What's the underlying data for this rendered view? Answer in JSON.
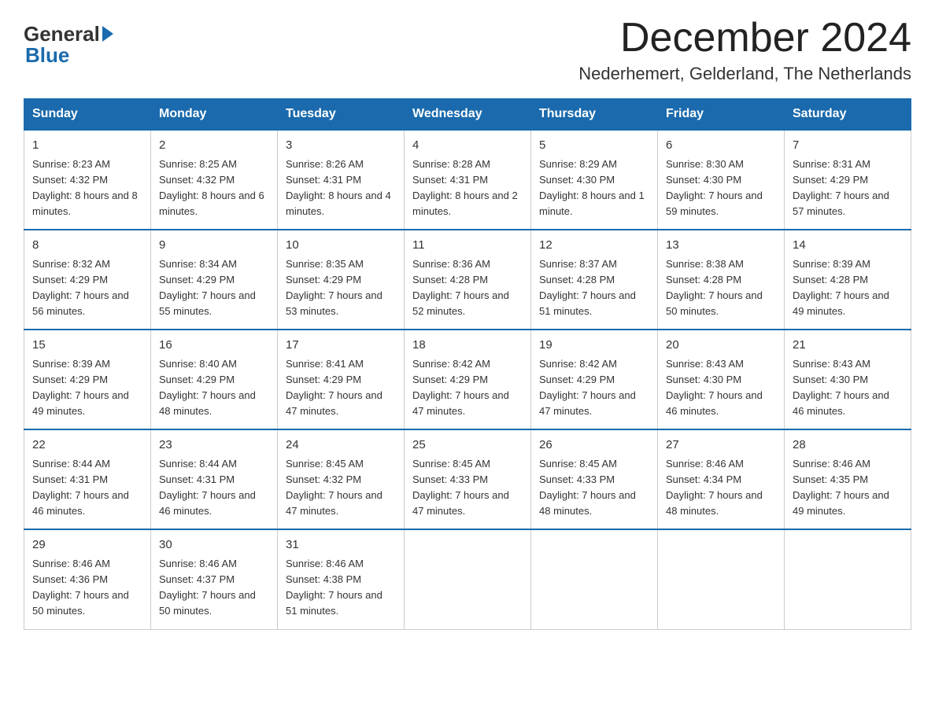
{
  "header": {
    "logo_general": "General",
    "logo_blue": "Blue",
    "month_year": "December 2024",
    "location": "Nederhemert, Gelderland, The Netherlands"
  },
  "days_of_week": [
    "Sunday",
    "Monday",
    "Tuesday",
    "Wednesday",
    "Thursday",
    "Friday",
    "Saturday"
  ],
  "weeks": [
    [
      {
        "day": "1",
        "sunrise": "8:23 AM",
        "sunset": "4:32 PM",
        "daylight": "8 hours and 8 minutes"
      },
      {
        "day": "2",
        "sunrise": "8:25 AM",
        "sunset": "4:32 PM",
        "daylight": "8 hours and 6 minutes"
      },
      {
        "day": "3",
        "sunrise": "8:26 AM",
        "sunset": "4:31 PM",
        "daylight": "8 hours and 4 minutes"
      },
      {
        "day": "4",
        "sunrise": "8:28 AM",
        "sunset": "4:31 PM",
        "daylight": "8 hours and 2 minutes"
      },
      {
        "day": "5",
        "sunrise": "8:29 AM",
        "sunset": "4:30 PM",
        "daylight": "8 hours and 1 minute"
      },
      {
        "day": "6",
        "sunrise": "8:30 AM",
        "sunset": "4:30 PM",
        "daylight": "7 hours and 59 minutes"
      },
      {
        "day": "7",
        "sunrise": "8:31 AM",
        "sunset": "4:29 PM",
        "daylight": "7 hours and 57 minutes"
      }
    ],
    [
      {
        "day": "8",
        "sunrise": "8:32 AM",
        "sunset": "4:29 PM",
        "daylight": "7 hours and 56 minutes"
      },
      {
        "day": "9",
        "sunrise": "8:34 AM",
        "sunset": "4:29 PM",
        "daylight": "7 hours and 55 minutes"
      },
      {
        "day": "10",
        "sunrise": "8:35 AM",
        "sunset": "4:29 PM",
        "daylight": "7 hours and 53 minutes"
      },
      {
        "day": "11",
        "sunrise": "8:36 AM",
        "sunset": "4:28 PM",
        "daylight": "7 hours and 52 minutes"
      },
      {
        "day": "12",
        "sunrise": "8:37 AM",
        "sunset": "4:28 PM",
        "daylight": "7 hours and 51 minutes"
      },
      {
        "day": "13",
        "sunrise": "8:38 AM",
        "sunset": "4:28 PM",
        "daylight": "7 hours and 50 minutes"
      },
      {
        "day": "14",
        "sunrise": "8:39 AM",
        "sunset": "4:28 PM",
        "daylight": "7 hours and 49 minutes"
      }
    ],
    [
      {
        "day": "15",
        "sunrise": "8:39 AM",
        "sunset": "4:29 PM",
        "daylight": "7 hours and 49 minutes"
      },
      {
        "day": "16",
        "sunrise": "8:40 AM",
        "sunset": "4:29 PM",
        "daylight": "7 hours and 48 minutes"
      },
      {
        "day": "17",
        "sunrise": "8:41 AM",
        "sunset": "4:29 PM",
        "daylight": "7 hours and 47 minutes"
      },
      {
        "day": "18",
        "sunrise": "8:42 AM",
        "sunset": "4:29 PM",
        "daylight": "7 hours and 47 minutes"
      },
      {
        "day": "19",
        "sunrise": "8:42 AM",
        "sunset": "4:29 PM",
        "daylight": "7 hours and 47 minutes"
      },
      {
        "day": "20",
        "sunrise": "8:43 AM",
        "sunset": "4:30 PM",
        "daylight": "7 hours and 46 minutes"
      },
      {
        "day": "21",
        "sunrise": "8:43 AM",
        "sunset": "4:30 PM",
        "daylight": "7 hours and 46 minutes"
      }
    ],
    [
      {
        "day": "22",
        "sunrise": "8:44 AM",
        "sunset": "4:31 PM",
        "daylight": "7 hours and 46 minutes"
      },
      {
        "day": "23",
        "sunrise": "8:44 AM",
        "sunset": "4:31 PM",
        "daylight": "7 hours and 46 minutes"
      },
      {
        "day": "24",
        "sunrise": "8:45 AM",
        "sunset": "4:32 PM",
        "daylight": "7 hours and 47 minutes"
      },
      {
        "day": "25",
        "sunrise": "8:45 AM",
        "sunset": "4:33 PM",
        "daylight": "7 hours and 47 minutes"
      },
      {
        "day": "26",
        "sunrise": "8:45 AM",
        "sunset": "4:33 PM",
        "daylight": "7 hours and 48 minutes"
      },
      {
        "day": "27",
        "sunrise": "8:46 AM",
        "sunset": "4:34 PM",
        "daylight": "7 hours and 48 minutes"
      },
      {
        "day": "28",
        "sunrise": "8:46 AM",
        "sunset": "4:35 PM",
        "daylight": "7 hours and 49 minutes"
      }
    ],
    [
      {
        "day": "29",
        "sunrise": "8:46 AM",
        "sunset": "4:36 PM",
        "daylight": "7 hours and 50 minutes"
      },
      {
        "day": "30",
        "sunrise": "8:46 AM",
        "sunset": "4:37 PM",
        "daylight": "7 hours and 50 minutes"
      },
      {
        "day": "31",
        "sunrise": "8:46 AM",
        "sunset": "4:38 PM",
        "daylight": "7 hours and 51 minutes"
      },
      null,
      null,
      null,
      null
    ]
  ],
  "labels": {
    "sunrise": "Sunrise:",
    "sunset": "Sunset:",
    "daylight": "Daylight:"
  }
}
